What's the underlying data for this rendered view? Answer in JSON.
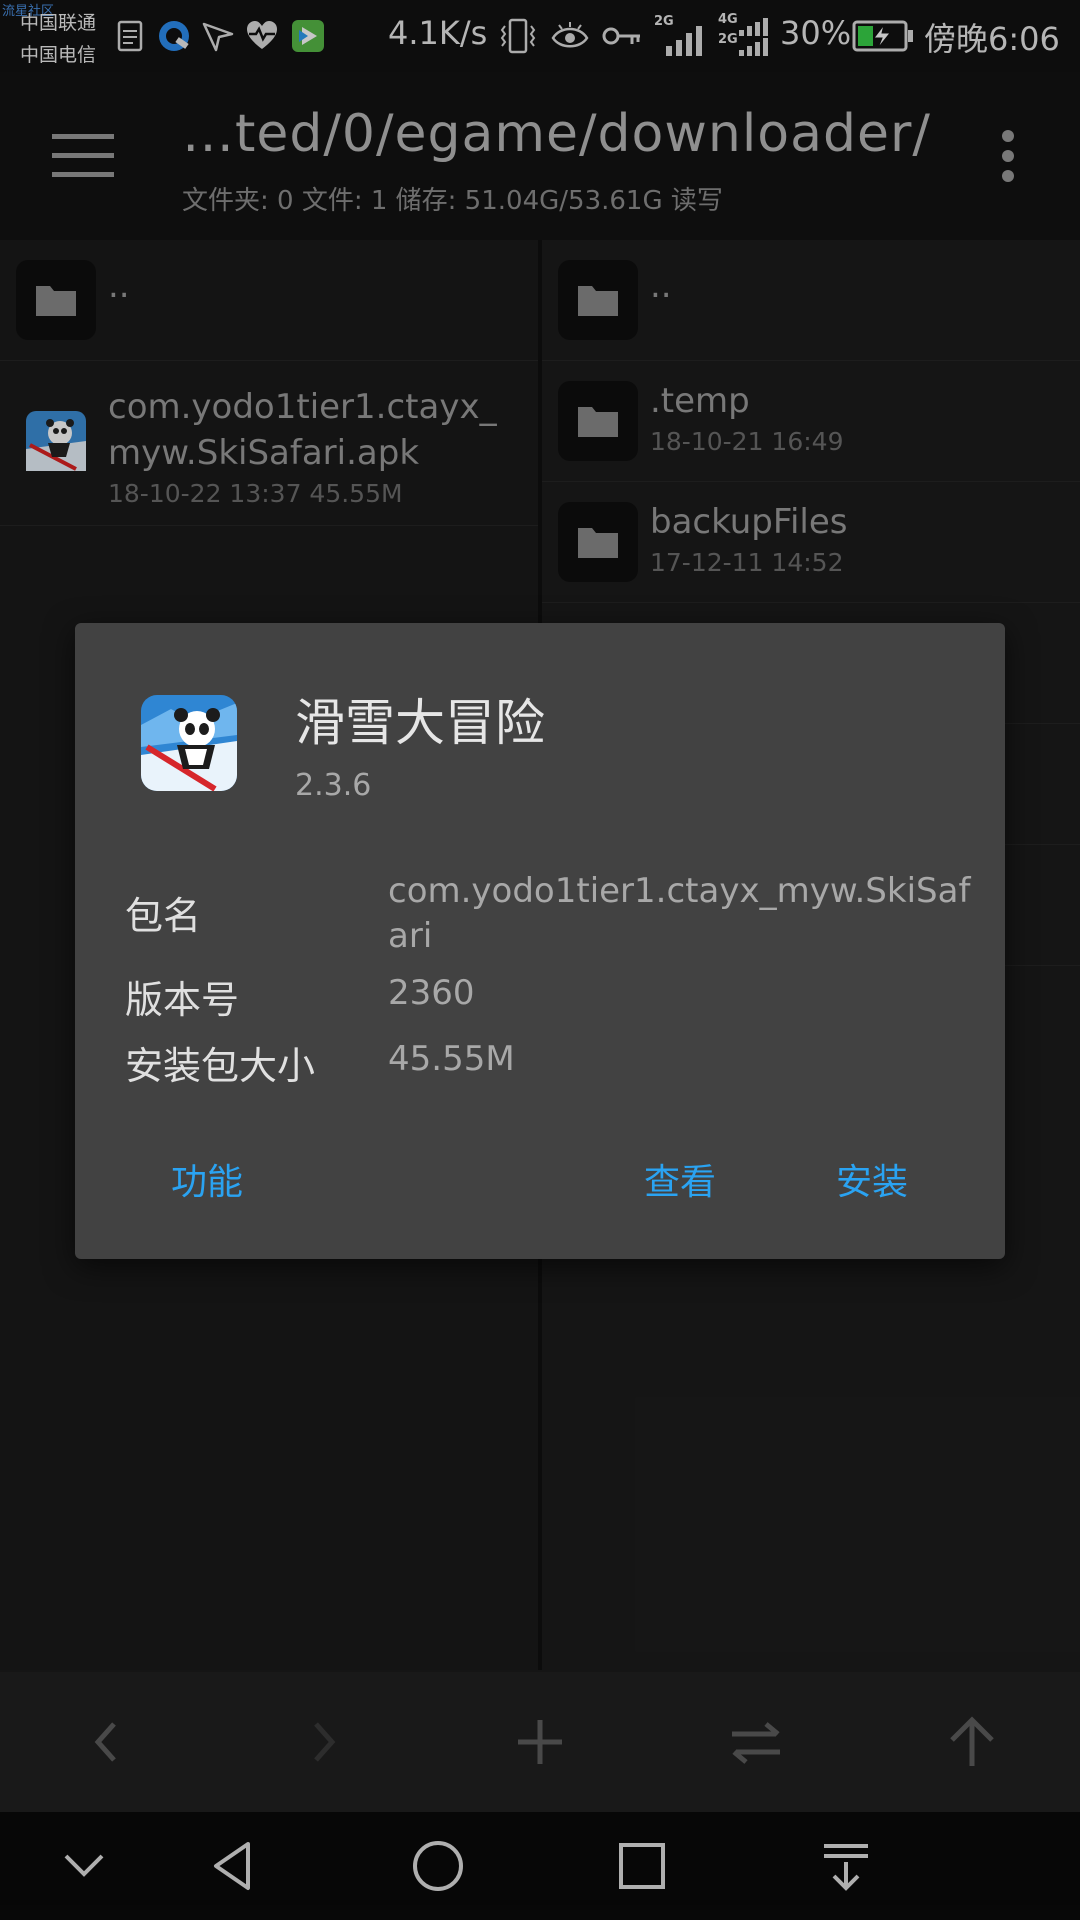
{
  "status_bar": {
    "watermark": "流星社区",
    "carrier_1": "中国联通",
    "carrier_2": "中国电信",
    "net_speed": "4.1K/s",
    "signal_1": "2G",
    "signal_2": "4G",
    "signal_3": "2G",
    "battery_percent": "30%",
    "time": "傍晚6:06",
    "icons": [
      "document-icon",
      "browser-icon",
      "location-arrow-icon",
      "heart-monitor-icon",
      "video-app-icon",
      "vibrate-icon",
      "eye-icon",
      "key-icon",
      "signal-icon",
      "battery-charging-icon"
    ]
  },
  "app_bar": {
    "path": "…ted/0/egame/downloader/",
    "summary": "文件夹: 0  文件: 1  储存: 51.04G/53.61G  读写"
  },
  "left_panel": {
    "parent_dir": "..",
    "files": [
      {
        "name_line1": "com.yodo1tier1.ctayx_",
        "name_line2": "myw.SkiSafari.apk",
        "meta": "18-10-22 13:37  45.55M"
      }
    ]
  },
  "right_panel": {
    "parent_dir": "..",
    "folders": [
      {
        "name": ".temp",
        "meta": "18-10-21 16:49"
      },
      {
        "name": "backupFiles",
        "meta": "17-12-11 14:52"
      }
    ]
  },
  "dialog": {
    "app_name": "滑雪大冒险",
    "version": "2.3.6",
    "rows": [
      {
        "label": "包名",
        "value": "com.yodo1tier1.ctayx_myw.SkiSafari"
      },
      {
        "label": "版本号",
        "value": "2360"
      },
      {
        "label": "安装包大小",
        "value": "45.55M"
      }
    ],
    "buttons": {
      "function": "功能",
      "view": "查看",
      "install": "安装"
    },
    "accent_color": "#2aa3f2"
  },
  "toolbar": {
    "icons": [
      "back-arrow-icon",
      "forward-arrow-icon",
      "add-icon",
      "swap-icon",
      "up-arrow-icon"
    ]
  },
  "nav_bar": {
    "icons": [
      "collapse-icon",
      "back-icon",
      "home-icon",
      "recents-icon",
      "notification-pull-icon"
    ]
  }
}
